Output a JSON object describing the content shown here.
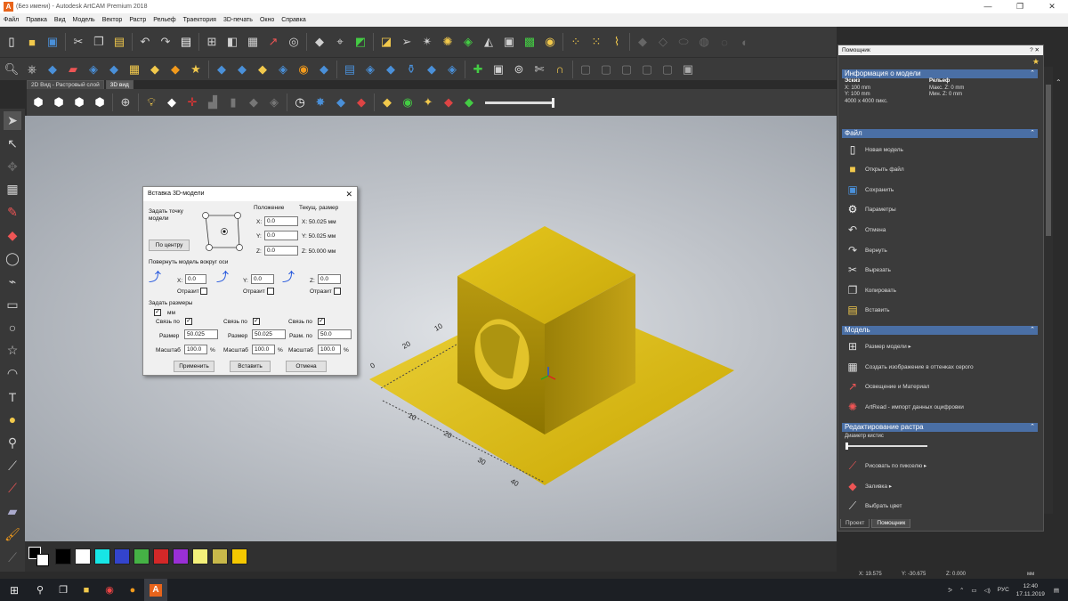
{
  "window": {
    "app_icon_letter": "A",
    "title": "(Без имени) - Autodesk ArtCAM Premium 2018",
    "minimize": "—",
    "maximize": "❐",
    "close": "✕"
  },
  "menu": [
    "Файл",
    "Правка",
    "Вид",
    "Модель",
    "Вектор",
    "Растр",
    "Рельеф",
    "Траектория",
    "3D-печать",
    "Окно",
    "Справка"
  ],
  "view_tabs": [
    {
      "label": "2D Вид - Растровый слой",
      "active": false
    },
    {
      "label": "3D вид",
      "active": true
    }
  ],
  "palette": [
    "#000000",
    "#ffffff",
    "#17e6e6",
    "#3344cc",
    "#45b245",
    "#d42828",
    "#9a2fd6",
    "#f4f07a",
    "#c8b84a",
    "#f5c800"
  ],
  "dialog": {
    "title": "Вставка 3D-модели",
    "close": "✕",
    "set_point_label": "Задать точку модели",
    "center_button": "По центру",
    "position_label": "Положение",
    "current_size_label": "Текущ. размер",
    "x_label": "X:",
    "y_label": "Y:",
    "z_label": "Z:",
    "pos_x": "0.0",
    "pos_y": "0.0",
    "pos_z": "0.0",
    "cur_x": "X: 50.025 мм",
    "cur_y": "Y: 50.025 мм",
    "cur_z": "Z: 50.000 мм",
    "rotate_label": "Повернуть модель вокруг оси",
    "rot_x": "0.0",
    "rot_y": "0.0",
    "rot_z": "0.0",
    "mirror_label": "Отразит",
    "set_sizes_label": "Задать размеры",
    "mm_label": "мм",
    "link_label": "Связь по",
    "size_label": "Размер",
    "size_z_label": "Разм. по",
    "scale_label": "Масштаб",
    "size_x": "50.025",
    "size_y": "50.025",
    "size_z": "50.0",
    "scale_x": "100.0",
    "scale_y": "100.0",
    "scale_z": "100.0",
    "percent": "%",
    "apply_button": "Применить",
    "insert_button": "Вставить",
    "cancel_button": "Отмена"
  },
  "panel": {
    "title": "Помощник",
    "title_ctrl": "? ✕",
    "model_info_header": "Информация о модели",
    "sketch_label": "Эскиз",
    "relief_label": "Рельеф",
    "sketch_x": "X: 100 mm",
    "sketch_y": "Y: 100 mm",
    "sketch_px": "4000 x 4000 пикс.",
    "relief_max": "Макс. Z: 0 mm",
    "relief_min": "Мин. Z: 0 mm",
    "file_header": "Файл",
    "file_items": [
      "Новая модель",
      "Открыть файл",
      "Сохранить",
      "Параметры",
      "Отмена",
      "Вернуть",
      "Вырезать",
      "Копировать",
      "Вставить"
    ],
    "model_header": "Модель",
    "model_items": [
      "Размер модели ▸",
      "Создать изображение в оттенках серого",
      "Освещение и Материал",
      "ArtRead - импорт данных оцифровки"
    ],
    "raster_header": "Редактирование растра",
    "brush_label": "Диаметр кистис",
    "raster_items": [
      "Рисовать по пикселю ▸",
      "Заливка ▸",
      "Выбрать цвет"
    ],
    "tabs": [
      "Проект",
      "Помощник"
    ]
  },
  "status": {
    "x": "X: 19.575",
    "y": "Y: -30.675",
    "z": "Z: 0.000",
    "units": "мм"
  },
  "taskbar": {
    "lang": "РУС",
    "time": "12:40",
    "date": "17.11.2019"
  },
  "scene": {
    "ruler_labels": [
      "40",
      "30",
      "20",
      "10",
      "0",
      "10",
      "20",
      "30",
      "40"
    ]
  }
}
